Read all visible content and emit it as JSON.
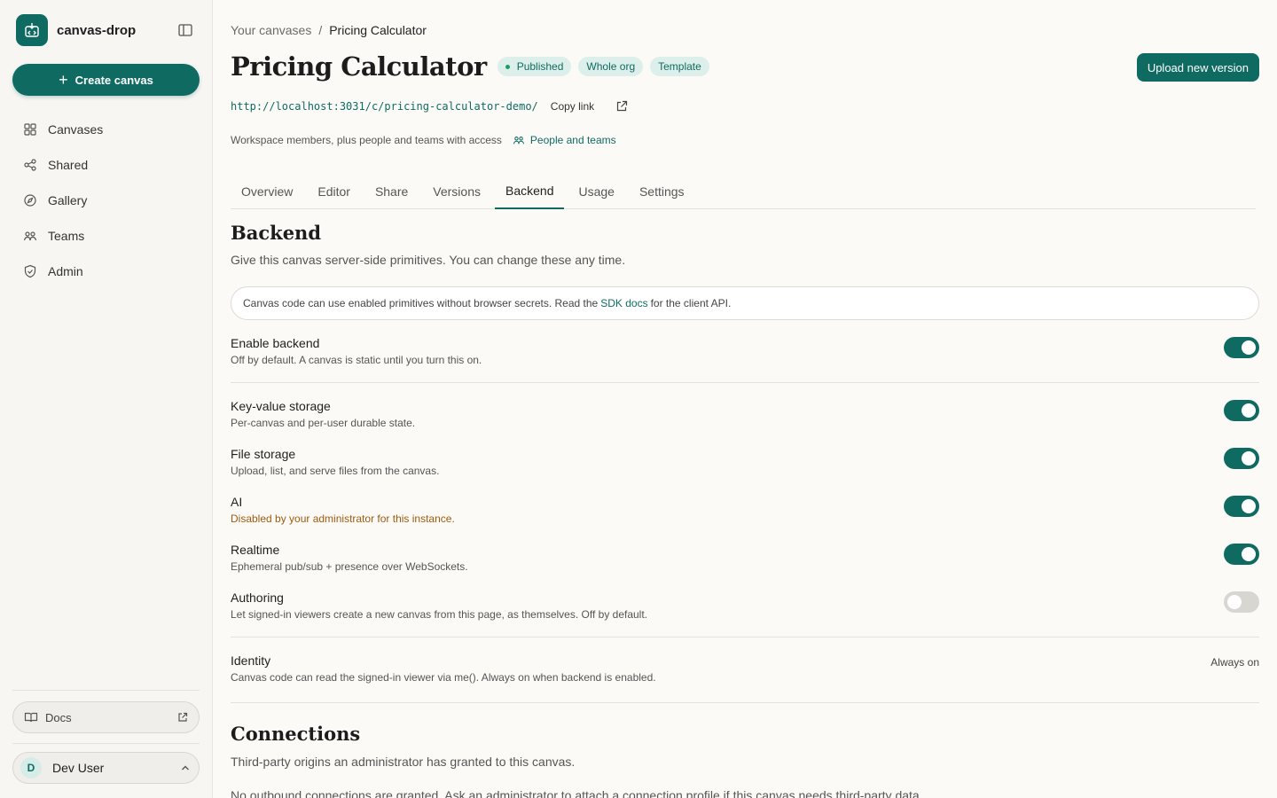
{
  "app": {
    "name": "canvas-drop",
    "accent": "#0f6b62"
  },
  "sidebar": {
    "create_label": "Create canvas",
    "items": [
      {
        "label": "Canvases",
        "icon": "grid-icon"
      },
      {
        "label": "Shared",
        "icon": "share-icon"
      },
      {
        "label": "Gallery",
        "icon": "compass-icon"
      },
      {
        "label": "Teams",
        "icon": "people-icon"
      },
      {
        "label": "Admin",
        "icon": "shield-icon"
      }
    ],
    "docs_label": "Docs",
    "user": {
      "initial": "D",
      "name": "Dev User"
    }
  },
  "breadcrumb": {
    "parent": "Your canvases",
    "separator": "/",
    "current": "Pricing Calculator"
  },
  "header": {
    "title": "Pricing Calculator",
    "badges": [
      "Published",
      "Whole org",
      "Template"
    ],
    "upload_label": "Upload new version",
    "url": "http://localhost:3031/c/pricing-calculator-demo/",
    "copy_label": "Copy link",
    "access_text": "Workspace members, plus people and teams with access",
    "access_link": "People and teams"
  },
  "tabs": [
    "Overview",
    "Editor",
    "Share",
    "Versions",
    "Backend",
    "Usage",
    "Settings"
  ],
  "active_tab": "Backend",
  "backend": {
    "title": "Backend",
    "description": "Give this canvas server-side primitives. You can change these any time.",
    "info_prefix": "Canvas code can use enabled primitives without browser secrets. Read the",
    "info_link": "SDK docs",
    "info_suffix": "for the client API.",
    "enable": {
      "label": "Enable backend",
      "desc": "Off by default. A canvas is static until you turn this on.",
      "on": true
    },
    "primitives": [
      {
        "label": "Key-value storage",
        "desc": "Per-canvas and per-user durable state.",
        "on": true,
        "warn": false
      },
      {
        "label": "File storage",
        "desc": "Upload, list, and serve files from the canvas.",
        "on": true,
        "warn": false
      },
      {
        "label": "AI",
        "desc": "Disabled by your administrator for this instance.",
        "on": true,
        "warn": true
      },
      {
        "label": "Realtime",
        "desc": "Ephemeral pub/sub + presence over WebSockets.",
        "on": true,
        "warn": false
      },
      {
        "label": "Authoring",
        "desc": "Let signed-in viewers create a new canvas from this page, as themselves. Off by default.",
        "on": false,
        "warn": false
      }
    ],
    "identity": {
      "label": "Identity",
      "desc": "Canvas code can read the signed-in viewer via me(). Always on when backend is enabled.",
      "status": "Always on"
    }
  },
  "connections": {
    "title": "Connections",
    "description": "Third-party origins an administrator has granted to this canvas.",
    "empty_text": "No outbound connections are granted. Ask an administrator to attach a connection profile if this canvas needs third-party data."
  }
}
